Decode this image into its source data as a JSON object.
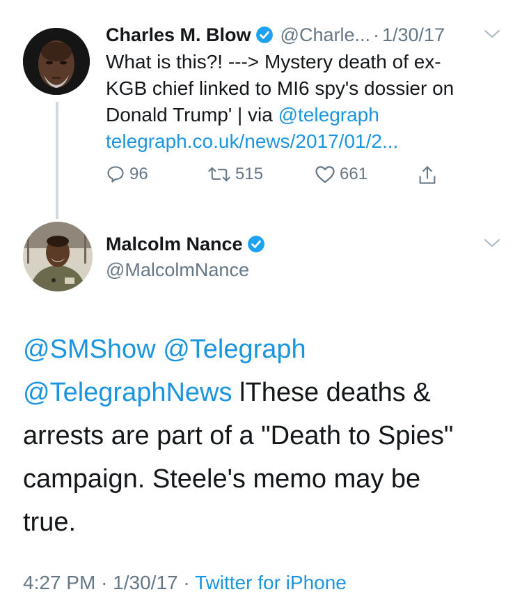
{
  "tweet1": {
    "display_name": "Charles M. Blow",
    "handle": "@Charle...",
    "separator": "·",
    "date": "1/30/17",
    "text_line1": "What is this?! ---> Mystery death of ex-",
    "text_line2": "KGB chief linked to MI6 spy's dossier on",
    "text_line3": "Donald Trump' | via ",
    "mention": "@telegraph",
    "link": "telegraph.co.uk/news/2017/01/2...",
    "replies": "96",
    "retweets": "515",
    "likes": "661"
  },
  "tweet2": {
    "display_name": "Malcolm Nance",
    "handle": "@MalcolmNance",
    "mention1": "@SMShow",
    "mention2": "@Telegraph",
    "mention3": "@TelegraphNews",
    "text_part1": " lThese deaths &",
    "text_line2": "arrests are part of a \"Death to Spies\"",
    "text_line3": "campaign. Steele's memo may be",
    "text_line4": "true.",
    "time": "4:27 PM",
    "dot1": "·",
    "date": "1/30/17",
    "dot2": "·",
    "source": "Twitter for iPhone"
  },
  "colors": {
    "link": "#1b95e0",
    "muted": "#657786",
    "text": "#14171a",
    "verified": "#1da1f2"
  },
  "icons": [
    "reply-icon",
    "retweet-icon",
    "like-icon",
    "share-icon",
    "chevron-down-icon",
    "verified-badge-icon"
  ]
}
